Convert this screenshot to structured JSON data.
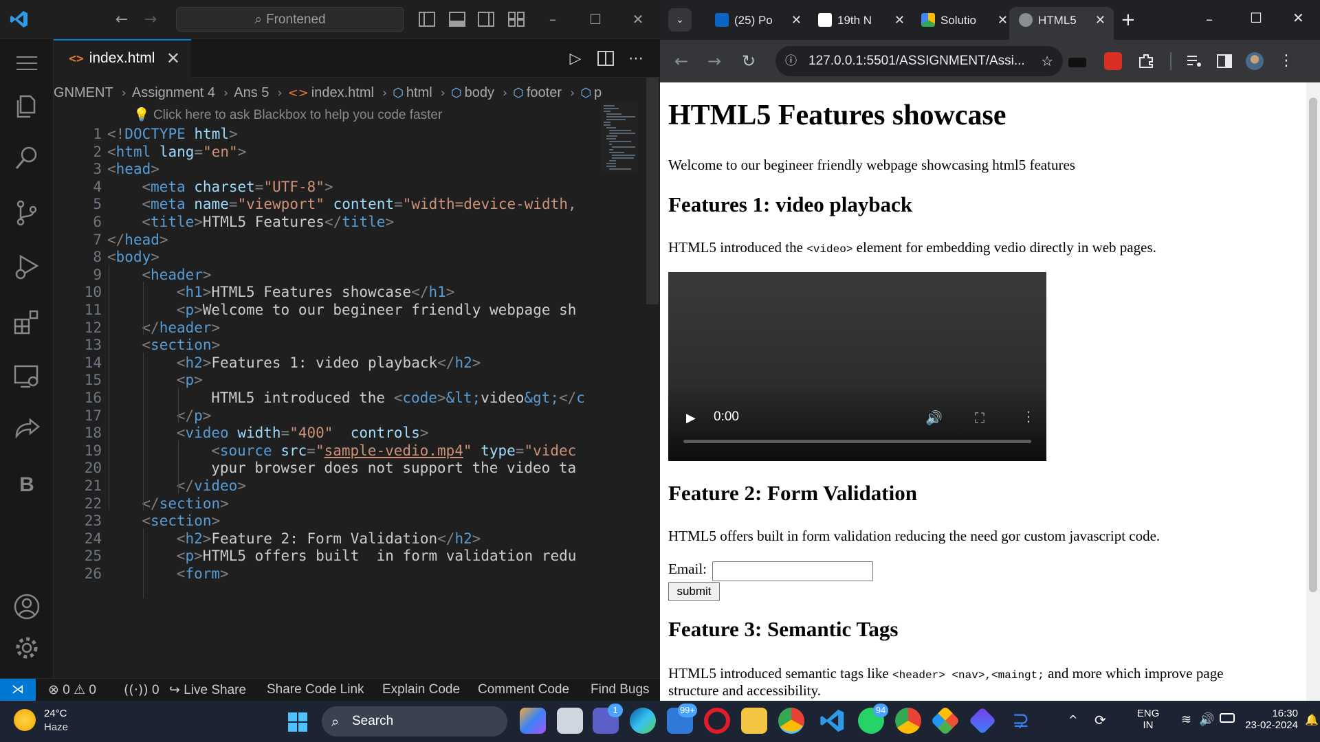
{
  "vscode": {
    "command_center": "Frontened",
    "active_tab": "index.html",
    "breadcrumb": [
      "GNMENT",
      "Assignment 4",
      "Ans 5",
      "index.html",
      "html",
      "body",
      "footer",
      "p"
    ],
    "blackbox_hint": "Click here to ask Blackbox to help you code faster",
    "status_bar": {
      "errors": "0",
      "warnings": "0",
      "ports": "0",
      "live_share": "Live Share",
      "share_code_link": "Share Code Link",
      "explain_code": "Explain Code",
      "comment_code": "Comment Code",
      "find_bugs": "Find Bugs"
    }
  },
  "code_lines": [
    {
      "n": "1"
    },
    {
      "n": "2"
    },
    {
      "n": "3"
    },
    {
      "n": "4"
    },
    {
      "n": "5"
    },
    {
      "n": "6"
    },
    {
      "n": "7"
    },
    {
      "n": "8"
    },
    {
      "n": "9"
    },
    {
      "n": "10"
    },
    {
      "n": "11"
    },
    {
      "n": "12"
    },
    {
      "n": "13"
    },
    {
      "n": "14"
    },
    {
      "n": "15"
    },
    {
      "n": "16"
    },
    {
      "n": "17"
    },
    {
      "n": "18"
    },
    {
      "n": "19"
    },
    {
      "n": "20"
    },
    {
      "n": "21"
    },
    {
      "n": "22"
    },
    {
      "n": "23"
    },
    {
      "n": "24"
    },
    {
      "n": "25"
    },
    {
      "n": "26"
    }
  ],
  "code": {
    "l1": [
      "<!",
      "DOCTYPE",
      " html",
      ">"
    ],
    "l2": [
      "<",
      "html",
      " lang",
      "=",
      "\"en\"",
      ">"
    ],
    "l3": [
      "<",
      "head",
      ">"
    ],
    "l4": [
      "<",
      "meta",
      " charset",
      "=",
      "\"UTF-8\"",
      ">"
    ],
    "l5": [
      "<",
      "meta",
      " name",
      "=",
      "\"viewport\"",
      " content",
      "=",
      "\"width=device-width,"
    ],
    "l6": [
      "<",
      "title",
      ">",
      "HTML5 Features",
      "</",
      "title",
      ">"
    ],
    "l7": [
      "</",
      "head",
      ">"
    ],
    "l8": [
      "<",
      "body",
      ">"
    ],
    "l9": [
      "<",
      "header",
      ">"
    ],
    "l10": [
      "<",
      "h1",
      ">",
      "HTML5 Features showcase",
      "</",
      "h1",
      ">"
    ],
    "l11": [
      "<",
      "p",
      ">",
      "Welcome to our begineer friendly webpage sh"
    ],
    "l12": [
      "</",
      "header",
      ">"
    ],
    "l13": [
      "<",
      "section",
      ">"
    ],
    "l14": [
      "<",
      "h2",
      ">",
      "Features 1: video playback",
      "</",
      "h2",
      ">"
    ],
    "l15": [
      "<",
      "p",
      ">"
    ],
    "l16": [
      "HTML5 introduced the ",
      "<",
      "code",
      ">",
      "&lt;",
      "video",
      "&gt;",
      "</",
      "c"
    ],
    "l17": [
      "</",
      "p",
      ">"
    ],
    "l18": [
      "<",
      "video",
      " width",
      "=",
      "\"400\"",
      "  controls",
      ">"
    ],
    "l19": [
      "<",
      "source",
      " src",
      "=",
      "\"",
      "sample-vedio.mp4",
      "\"",
      " type",
      "=",
      "\"videc"
    ],
    "l20": [
      "ypur browser does not support the video ta"
    ],
    "l21": [
      "</",
      "video",
      ">"
    ],
    "l22": [
      "</",
      "section",
      ">"
    ],
    "l23": [
      "<",
      "section",
      ">"
    ],
    "l24": [
      "<",
      "h2",
      ">",
      "Feature 2: Form Validation",
      "</",
      "h2",
      ">"
    ],
    "l25": [
      "<",
      "p",
      ">",
      "HTML5 offers built  in form validation redu"
    ],
    "l26": [
      "<",
      "form",
      ">"
    ]
  },
  "chrome": {
    "tabs": [
      "(25) Po",
      "19th N",
      "Solutio",
      "HTML5"
    ],
    "url": "127.0.0.1:5501/ASSIGNMENT/Assi..."
  },
  "page": {
    "h1": "HTML5 Features showcase",
    "intro": "Welcome to our begineer friendly webpage showcasing html5 features",
    "f1_title": "Features 1: video playback",
    "f1_text_a": "HTML5 introduced the ",
    "f1_code": "<video>",
    "f1_text_b": " element for embedding vedio directly in web pages.",
    "video_time": "0:00",
    "f2_title": "Feature 2: Form Validation",
    "f2_text": "HTML5 offers built in form validation reducing the need gor custom javascript code.",
    "email_label": "Email:",
    "submit_label": "submit",
    "f3_title": "Feature 3: Semantic Tags",
    "f3_text_a": "HTML5 introduced semantic tags like ",
    "f3_code_a": "<header>",
    "f3_code_b": " <nav>",
    "f3_code_c": ",<maingt;",
    "f3_text_b": " and more which improve page",
    "f3_text_c": "structure and accessibility."
  },
  "taskbar": {
    "temp": "24°C",
    "condition": "Haze",
    "search": "Search",
    "badge_teams": "1",
    "badge_mail": "99+",
    "badge_whatsapp": "94",
    "lang_1": "ENG",
    "lang_2": "IN",
    "time": "16:30",
    "date": "23-02-2024"
  },
  "colors": {
    "accent": "#0078d4",
    "tag": "#569cd6",
    "attr": "#9cdcfe",
    "string": "#ce9178",
    "taskbar": "#1c2433"
  }
}
